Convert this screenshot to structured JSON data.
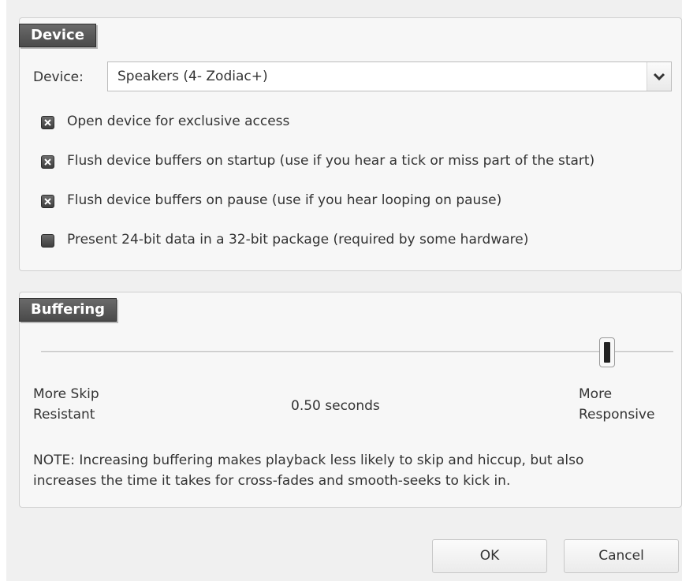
{
  "device_section": {
    "title": "Device",
    "device_label": "Device:",
    "device_value": "Speakers (4- Zodiac+)",
    "options": [
      {
        "label": "Open device for exclusive access",
        "checked": true
      },
      {
        "label": "Flush device buffers on startup (use if you hear a tick or miss part of the start)",
        "checked": true
      },
      {
        "label": "Flush device buffers on pause (use if you hear looping on pause)",
        "checked": true
      },
      {
        "label": "Present 24-bit data in a 32-bit package (required by some hardware)",
        "checked": false
      }
    ]
  },
  "buffering_section": {
    "title": "Buffering",
    "left_label_line1": "More Skip",
    "left_label_line2": "Resistant",
    "value_text": "0.50 seconds",
    "right_label_line1": "More",
    "right_label_line2": "Responsive",
    "slider_fraction": 0.91,
    "note_line1": "NOTE: Increasing buffering makes playback less likely to skip and hiccup, but also",
    "note_line2": "increases the time it takes for cross-fades and smooth-seeks to kick in."
  },
  "buttons": {
    "ok": "OK",
    "cancel": "Cancel"
  },
  "icons": {
    "checked": "x-check-icon",
    "unchecked": "empty-check-icon",
    "dropdown": "chevron-down-icon",
    "cursor": "mouse-cursor-icon"
  }
}
